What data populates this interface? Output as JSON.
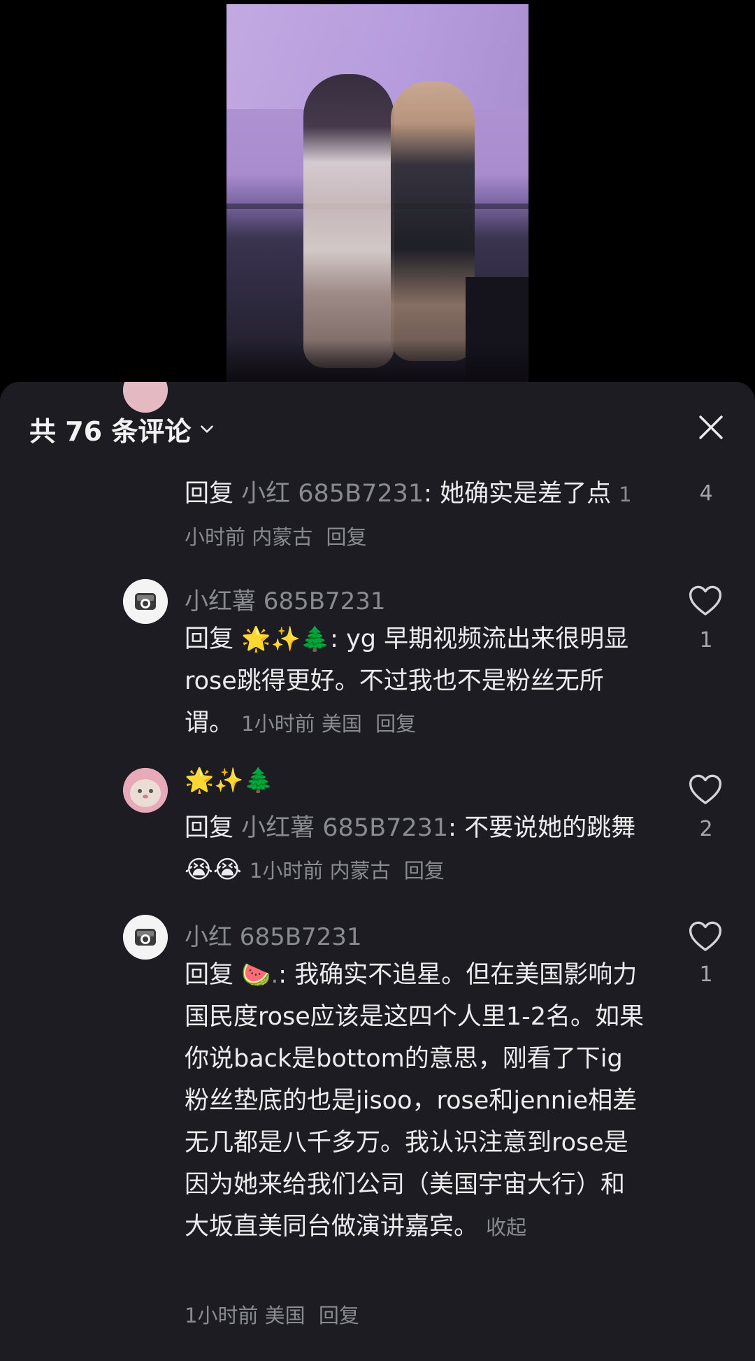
{
  "header": {
    "title": "共 76 条评论"
  },
  "comments": [
    {
      "prefix": "回复 ",
      "target": "小红 685B7231",
      "text": ": 她确实是差了点",
      "time": "1小时前",
      "location": "内蒙古",
      "reply_label": "回复",
      "likes": "4"
    },
    {
      "name": "小红薯 685B7231",
      "prefix": "回复 ",
      "target": "🌟✨🌲",
      "text": ": yg 早期视频流出来很明显rose跳得更好。不过我也不是粉丝无所谓。",
      "time": "1小时前",
      "location": "美国",
      "reply_label": "回复",
      "likes": "1"
    },
    {
      "name": "🌟✨🌲",
      "prefix": "回复 ",
      "target": "小红薯 685B7231",
      "text": ": 不要说她的跳舞😭😭",
      "time": "1小时前",
      "location": "内蒙古",
      "reply_label": "回复",
      "likes": "2"
    },
    {
      "name": "小红 685B7231",
      "prefix": "回复 ",
      "target": "🍉.",
      "text": ": 我确实不追星。但在美国影响力国民度rose应该是这四个人里1-2名。如果你说back是bottom的意思，刚看了下ig粉丝垫底的也是jisoo，rose和jennie相差无几都是八千多万。我认识注意到rose是因为她来给我们公司（美国宇宙大行）和大坂直美同台做演讲嘉宾。",
      "collapse": "收起",
      "time": "1小时前",
      "location": "美国",
      "reply_label": "回复",
      "likes": "1"
    }
  ]
}
